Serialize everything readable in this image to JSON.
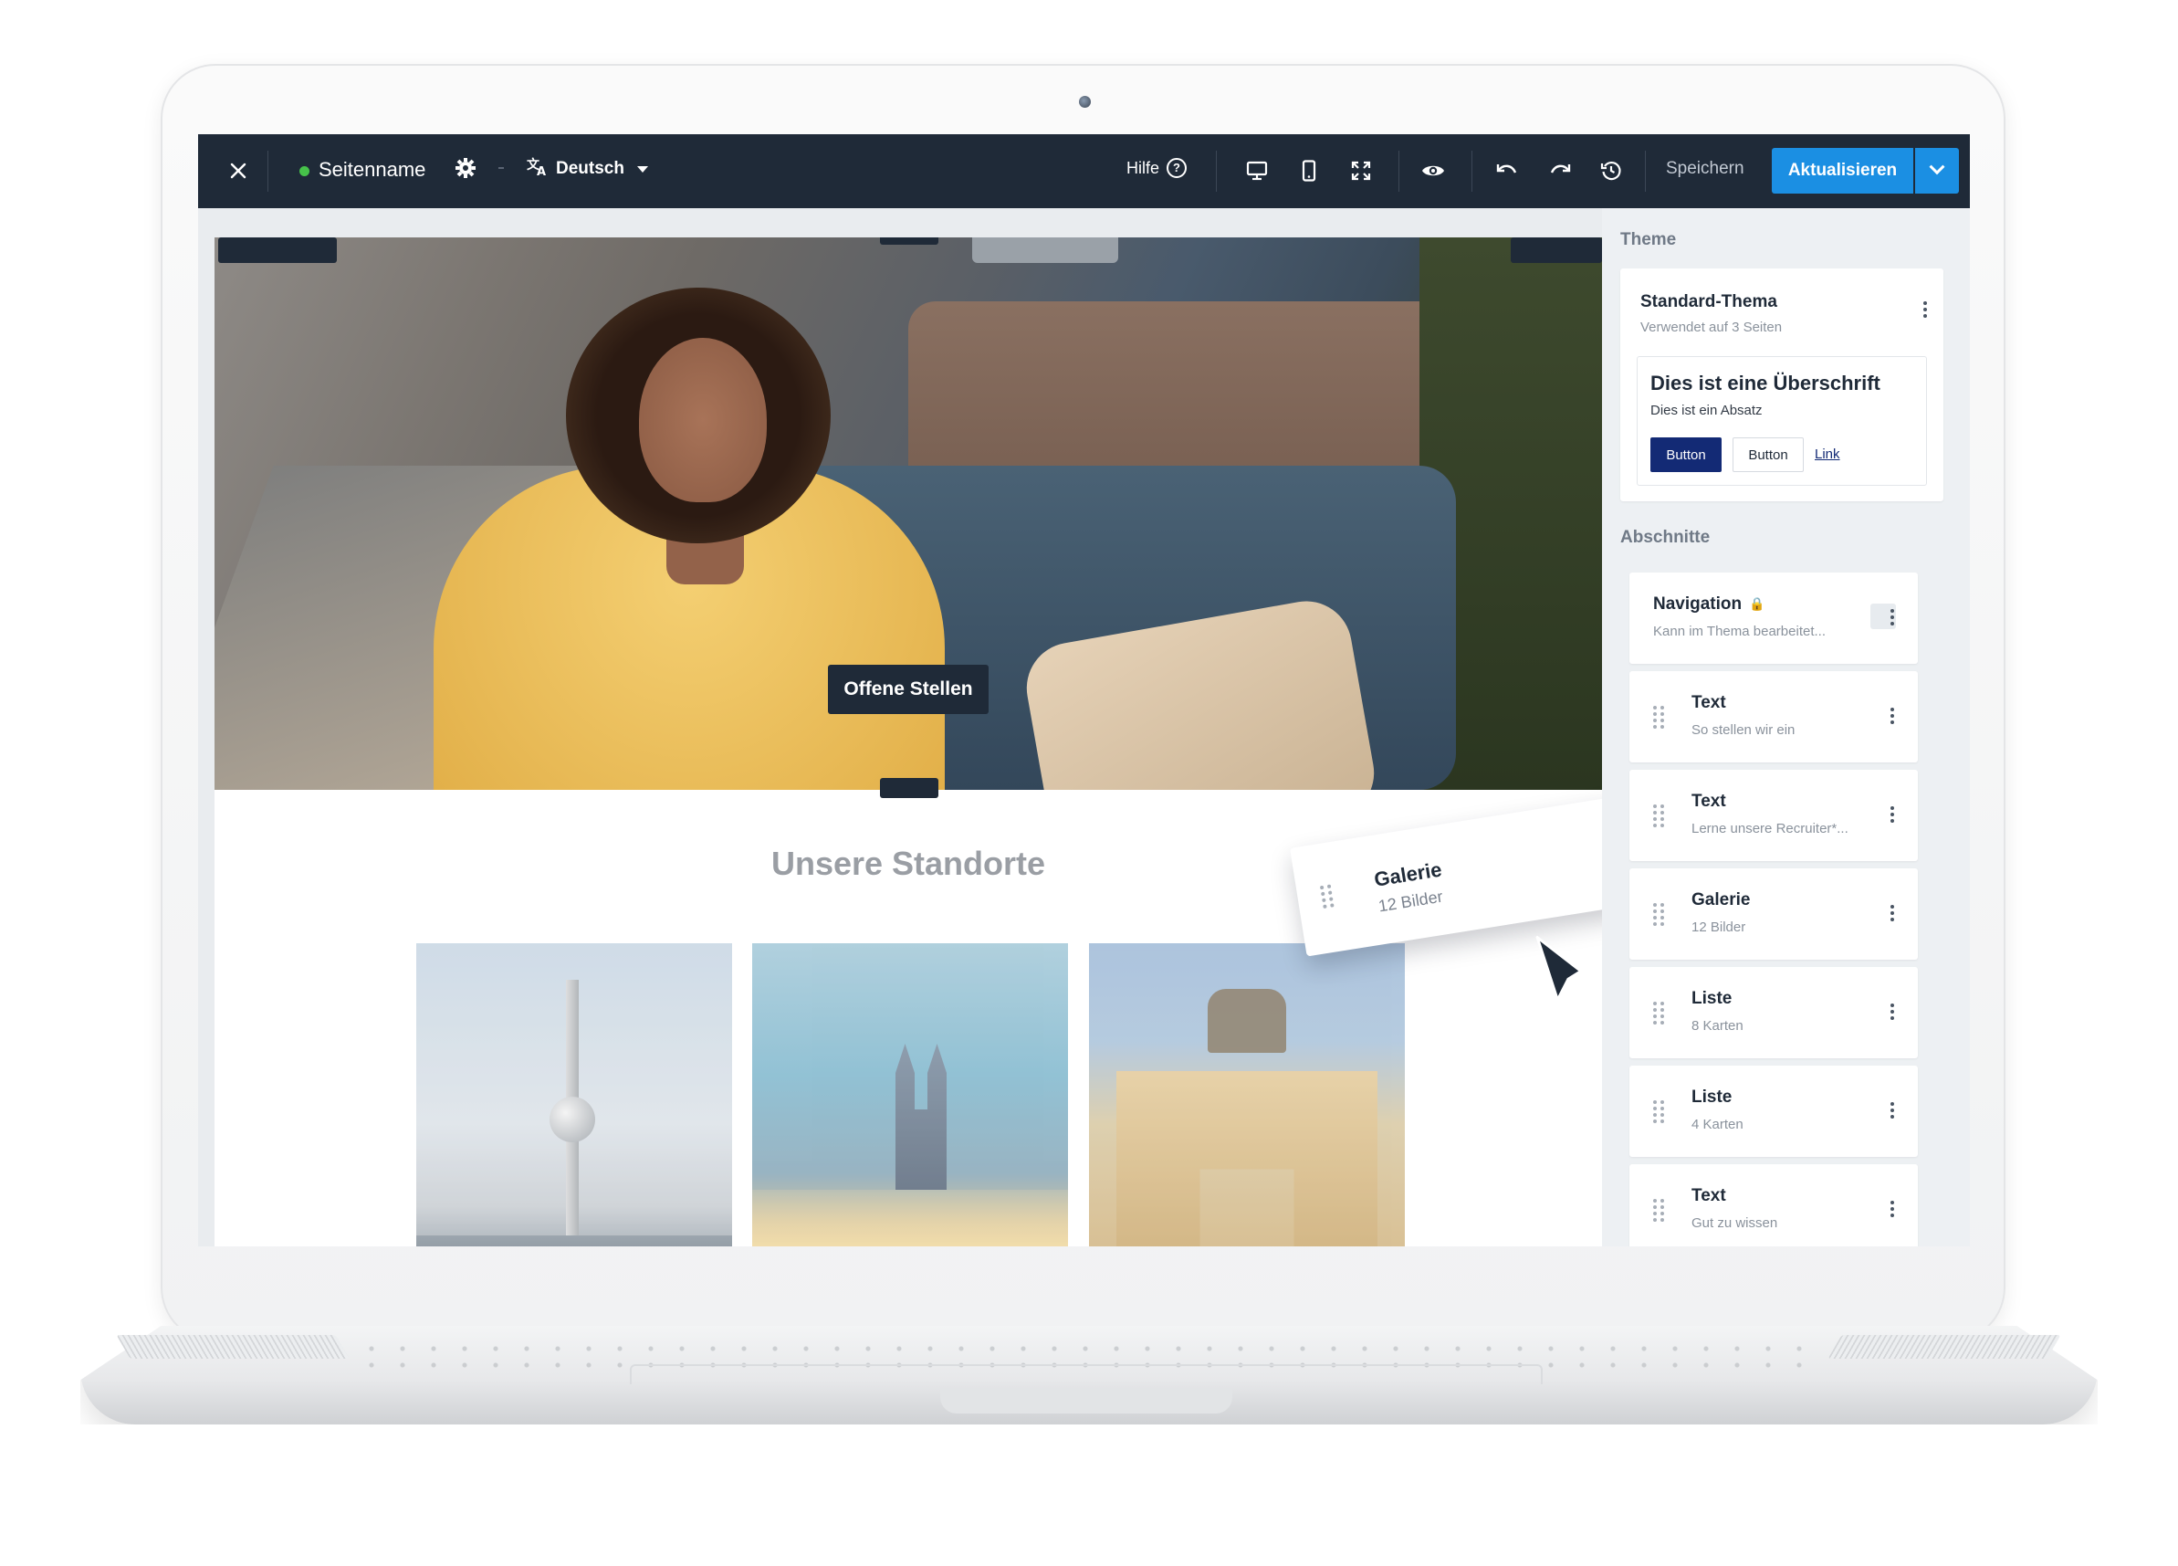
{
  "toolbar": {
    "page_name": "Seitenname",
    "language": "Deutsch",
    "help_label": "Hilfe",
    "save_label": "Speichern",
    "update_label": "Aktualisieren"
  },
  "canvas": {
    "hero_button_label": "Offene Stellen",
    "section_title": "Unsere Standorte"
  },
  "drag_card": {
    "title": "Galerie",
    "subtitle": "12 Bilder"
  },
  "panel": {
    "theme_label": "Theme",
    "theme": {
      "name": "Standard-Thema",
      "usage": "Verwendet auf 3 Seiten",
      "preview_heading": "Dies ist eine Überschrift",
      "preview_paragraph": "Dies ist ein Absatz",
      "preview_button_primary": "Button",
      "preview_button_secondary": "Button",
      "preview_link": "Link"
    },
    "sections_label": "Abschnitte",
    "sections": [
      {
        "title": "Navigation",
        "subtitle": "Kann im Thema bearbeitet..."
      },
      {
        "title": "Text",
        "subtitle": "So stellen wir ein"
      },
      {
        "title": "Text",
        "subtitle": "Lerne unsere Recruiter*..."
      },
      {
        "title": "Galerie",
        "subtitle": "12 Bilder"
      },
      {
        "title": "Liste",
        "subtitle": "8 Karten"
      },
      {
        "title": "Liste",
        "subtitle": "4 Karten"
      },
      {
        "title": "Text",
        "subtitle": "Gut zu wissen"
      }
    ]
  },
  "colors": {
    "toolbar_bg": "#1f2a38",
    "accent_blue": "#1b8fe3",
    "status_online": "#46c24a",
    "theme_primary": "#132a75"
  },
  "icons": [
    "close-icon",
    "gear-icon",
    "translate-icon",
    "chevron-down-icon",
    "help-icon",
    "desktop-icon",
    "mobile-icon",
    "fullscreen-icon",
    "eye-icon",
    "undo-icon",
    "redo-icon",
    "history-icon",
    "drag-grip-icon",
    "kebab-menu-icon",
    "lock-icon",
    "cursor-icon"
  ]
}
